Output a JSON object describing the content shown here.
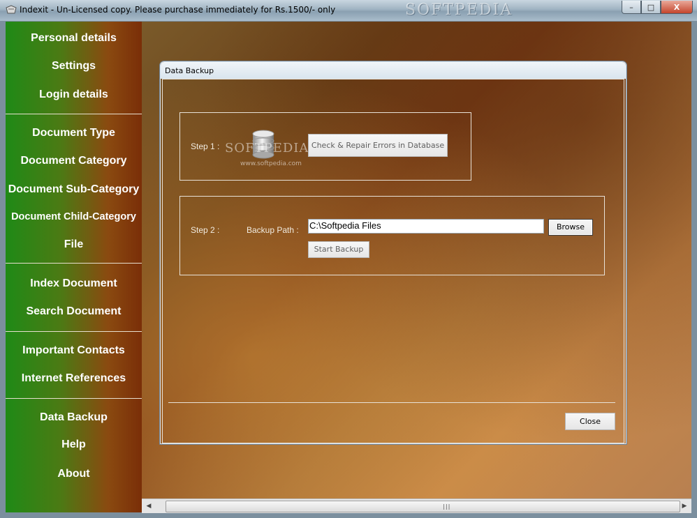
{
  "window": {
    "title": "Indexit - Un-Licensed copy. Please purchase immediately for Rs.1500/- only",
    "watermark": "SOFTPEDIA",
    "buttons": {
      "minimize": "–",
      "maximize": "□",
      "close": "X"
    }
  },
  "sidebar": {
    "items": [
      "Personal details",
      "Settings",
      "Login details",
      "Document Type",
      "Document Category",
      "Document Sub-Category",
      "Document Child-Category",
      "File",
      "Index Document",
      "Search Document",
      "Important Contacts",
      "Internet References",
      "Data Backup",
      "Help",
      "About"
    ]
  },
  "dialog": {
    "title": "Data Backup",
    "step1": {
      "label": "Step 1 :",
      "icon": "database-icon",
      "button": "Check & Repair Errors in Database",
      "watermark": "SOFTPEDIA",
      "watermark_url": "www.softpedia.com"
    },
    "step2": {
      "label": "Step 2 :",
      "path_label": "Backup Path :",
      "path_value": "C:\\Softpedia Files",
      "browse": "Browse",
      "start": "Start Backup"
    },
    "close": "Close"
  },
  "scrollbar": {
    "left_arrow": "◀",
    "right_arrow": "▶",
    "grip": "|||"
  }
}
